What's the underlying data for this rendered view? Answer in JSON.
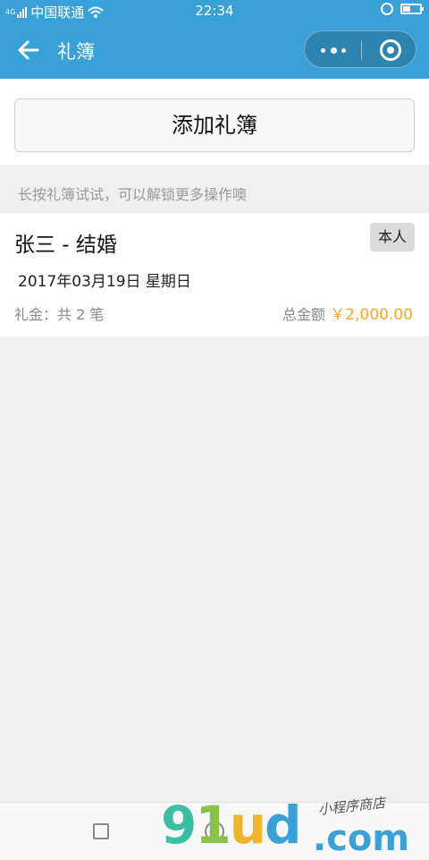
{
  "status_bar": {
    "network_type": "4G",
    "carrier": "中国联通",
    "time": "22:34"
  },
  "nav": {
    "title": "礼簿"
  },
  "add_button": {
    "label": "添加礼簿"
  },
  "hint": "长按礼簿试试，可以解锁更多操作噢",
  "books": [
    {
      "title": "张三 - 结婚",
      "badge": "本人",
      "date": "2017年03月19日 星期日",
      "count_text": "礼金：共 2 笔",
      "total_label": "总金额",
      "total_amount": "￥2,000.00"
    }
  ],
  "watermark": {
    "brand": "91ud",
    "brand_parts": [
      "9",
      "1",
      "u",
      "d"
    ],
    "domain": ".com",
    "signature": "小程序商店"
  },
  "colors": {
    "primary": "#3aa0d8",
    "amount": "#f5a623",
    "background": "#efefef"
  },
  "icons": {
    "back": "arrow-left-icon",
    "more": "more-dots-icon",
    "close": "target-circle-icon",
    "recent": "square-icon",
    "home": "circle-icon"
  }
}
